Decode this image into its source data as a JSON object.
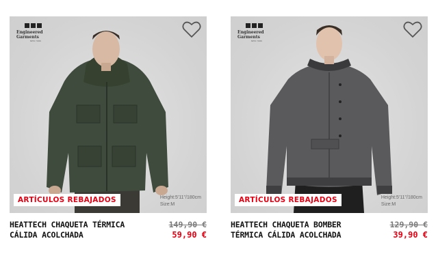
{
  "colors": {
    "sale_red": "#e60012",
    "text": "#111111",
    "muted": "#7a7a7a"
  },
  "products": [
    {
      "logo_brand": "Engineered Garments",
      "logo_sub": "NEW YORK",
      "badge": "ARTÍCULOS REBAJADOS",
      "model_height": "Height:5'11\"/180cm",
      "model_size": "Size:M",
      "name": "HEATTECH CHAQUETA TÉRMICA CÁLIDA ACOLCHADA",
      "old_price": "149,90 €",
      "new_price": "59,90 €",
      "jacket_color": "#3f4b3d",
      "wishlist_icon": "heart-outline-icon"
    },
    {
      "logo_brand": "Engineered Garments",
      "logo_sub": "NEW YORK",
      "badge": "ARTÍCULOS REBAJADOS",
      "model_height": "Height:5'11\"/180cm",
      "model_size": "Size:M",
      "name": "HEATTECH CHAQUETA BOMBER TÉRMICA CÁLIDA ACOLCHADA",
      "old_price": "129,90 €",
      "new_price": "39,90 €",
      "jacket_color": "#5a5a5c",
      "wishlist_icon": "heart-outline-icon"
    }
  ]
}
